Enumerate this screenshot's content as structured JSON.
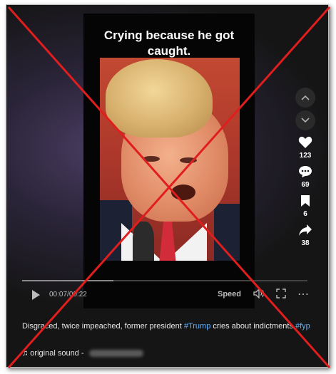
{
  "video": {
    "caption_line1": "Crying because he got",
    "caption_line2": "caught."
  },
  "actions": {
    "likes": "123",
    "comments": "69",
    "saves": "6",
    "shares": "38"
  },
  "player": {
    "current_time": "00:07",
    "separator": "/",
    "duration": "00:22",
    "speed_label": "Speed",
    "progress_fraction": 0.32
  },
  "post": {
    "description_text": "Disgraced, twice impeached, former president ",
    "hashtag_trump": "#Trump",
    "description_text_2": " cries about indictments ",
    "hashtag_fyp": "#fyp",
    "sound_prefix": "♫ original sound - "
  },
  "colors": {
    "overlay_x": "#e01e1e",
    "hashtag": "#5fb0ff",
    "background": "#151515"
  },
  "icons": [
    "chevron-up-icon",
    "chevron-down-icon",
    "heart-icon",
    "comment-icon",
    "bookmark-icon",
    "share-icon",
    "play-icon",
    "volume-icon",
    "fullscreen-icon",
    "more-icon",
    "music-note-icon"
  ]
}
